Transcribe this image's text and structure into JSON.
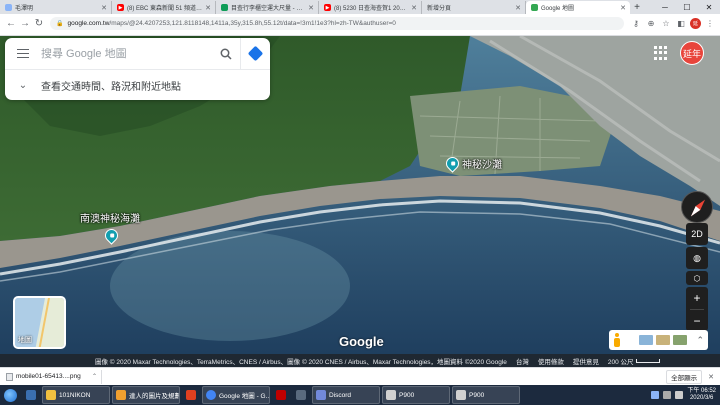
{
  "browser": {
    "tabs": [
      {
        "label": "毛澤明",
        "fav_color": "#8ab4f8",
        "active": false
      },
      {
        "label": "(8) EBC 東森新聞 51 頻道 24 小",
        "fav_color": "#ff0000",
        "active": false
      },
      {
        "label": "目查行李櫃空運大尺量 - 挑戰",
        "fav_color": "#0f9d58",
        "active": false
      },
      {
        "label": "(8) 5230 日查海查賀1 2018/6/",
        "fav_color": "#ff0000",
        "active": false
      },
      {
        "label": "新增分頁",
        "fav_color": "#dadce0",
        "active": false
      },
      {
        "label": "Google 地圖",
        "fav_color": "#34a853",
        "active": true
      }
    ],
    "new_tab": "+",
    "url_host": "google.com.tw",
    "url_rest": "/maps/@24.4207253,121.8118148,1411a,35y,315.8h,55.12t/data=!3m1!1e3?hl=zh-TW&authuser=0",
    "toolbar_icons": [
      "key-icon",
      "zoom-icon",
      "star-icon",
      "extension-icon",
      "profile-icon",
      "menu-icon"
    ]
  },
  "maps": {
    "search_placeholder": "搜尋 Google 地圖",
    "transit_label": "查看交通時間、路況和附近地點",
    "user_avatar": "延年",
    "places": [
      {
        "name": "神秘沙灘"
      },
      {
        "name": "南澳神秘海灘"
      }
    ],
    "view_toggle": "2D",
    "zoom_in": "+",
    "zoom_out": "−",
    "layer_label": "地圖",
    "logo": "Google",
    "footer": {
      "imagery_1": "圖像 © 2020 Maxar Technologies、TerraMetrics、CNES / Airbus、圖像 © 2020 CNES / Airbus、Maxar Technologies，地圖資料 ©2020 Google",
      "region": "台灣",
      "terms": "使用條款",
      "feedback": "提供意見",
      "scale": "200 公尺"
    }
  },
  "downloads": {
    "item": "mobile01-65413....png",
    "show_all": "全部顯示"
  },
  "taskbar": {
    "tasks": [
      {
        "label": "101NIKON",
        "color": "#f0c040",
        "wide": true
      },
      {
        "label": "達人的圖片及規劃",
        "color": "#f0a030",
        "wide": true
      },
      {
        "label": "",
        "color": "#e04020",
        "wide": false
      },
      {
        "label": "Google 地圖 - G...",
        "color": "#4285f4",
        "wide": true
      },
      {
        "label": "",
        "color": "#c00000",
        "wide": false
      },
      {
        "label": "",
        "color": "#1b2838",
        "wide": false
      },
      {
        "label": "Discord",
        "color": "#7289da",
        "wide": true
      },
      {
        "label": "P900",
        "color": "#d0d0d0",
        "wide": true
      },
      {
        "label": "P900",
        "color": "#d0d0d0",
        "wide": true
      }
    ],
    "time": "下午 06:52",
    "date": "2020/3/6"
  }
}
